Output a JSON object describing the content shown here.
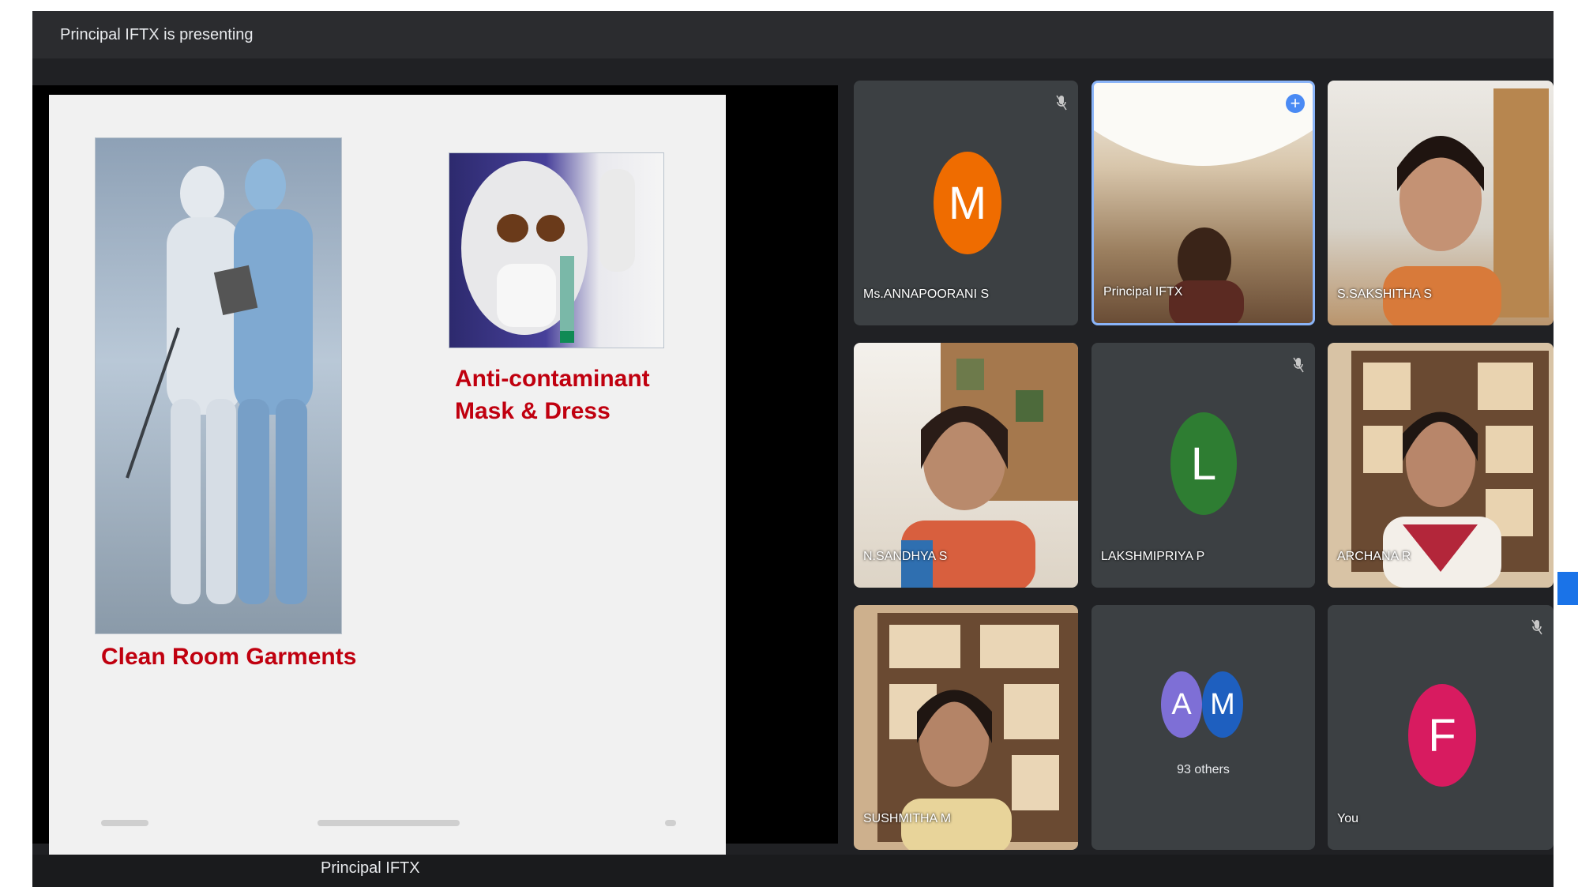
{
  "topbar": {
    "presenting_label": "Principal IFTX is presenting"
  },
  "slide": {
    "caption_left": "Clean Room Garments",
    "caption_right_line1": "Anti-contaminant",
    "caption_right_line2": "Mask & Dress"
  },
  "tiles": [
    {
      "name": "Ms.ANNAPOORANI S",
      "avatar_letter": "M",
      "avatar_color": "#ef6c00"
    },
    {
      "name": "Principal IFTX"
    },
    {
      "name": "S.SAKSHITHA S"
    },
    {
      "name": "N.SANDHYA S"
    },
    {
      "name": "LAKSHMIPRIYA P",
      "avatar_letter": "L",
      "avatar_color": "#2e7d32"
    },
    {
      "name": "ARCHANA R"
    },
    {
      "name": "SUSHMITHA M"
    },
    {
      "others_label": "93 others",
      "avatar_a": "A",
      "avatar_m": "M"
    },
    {
      "name": "You",
      "avatar_letter": "F",
      "avatar_color": "#d81b60"
    }
  ],
  "bottombar": {
    "presenter_name": "Principal IFTX"
  }
}
